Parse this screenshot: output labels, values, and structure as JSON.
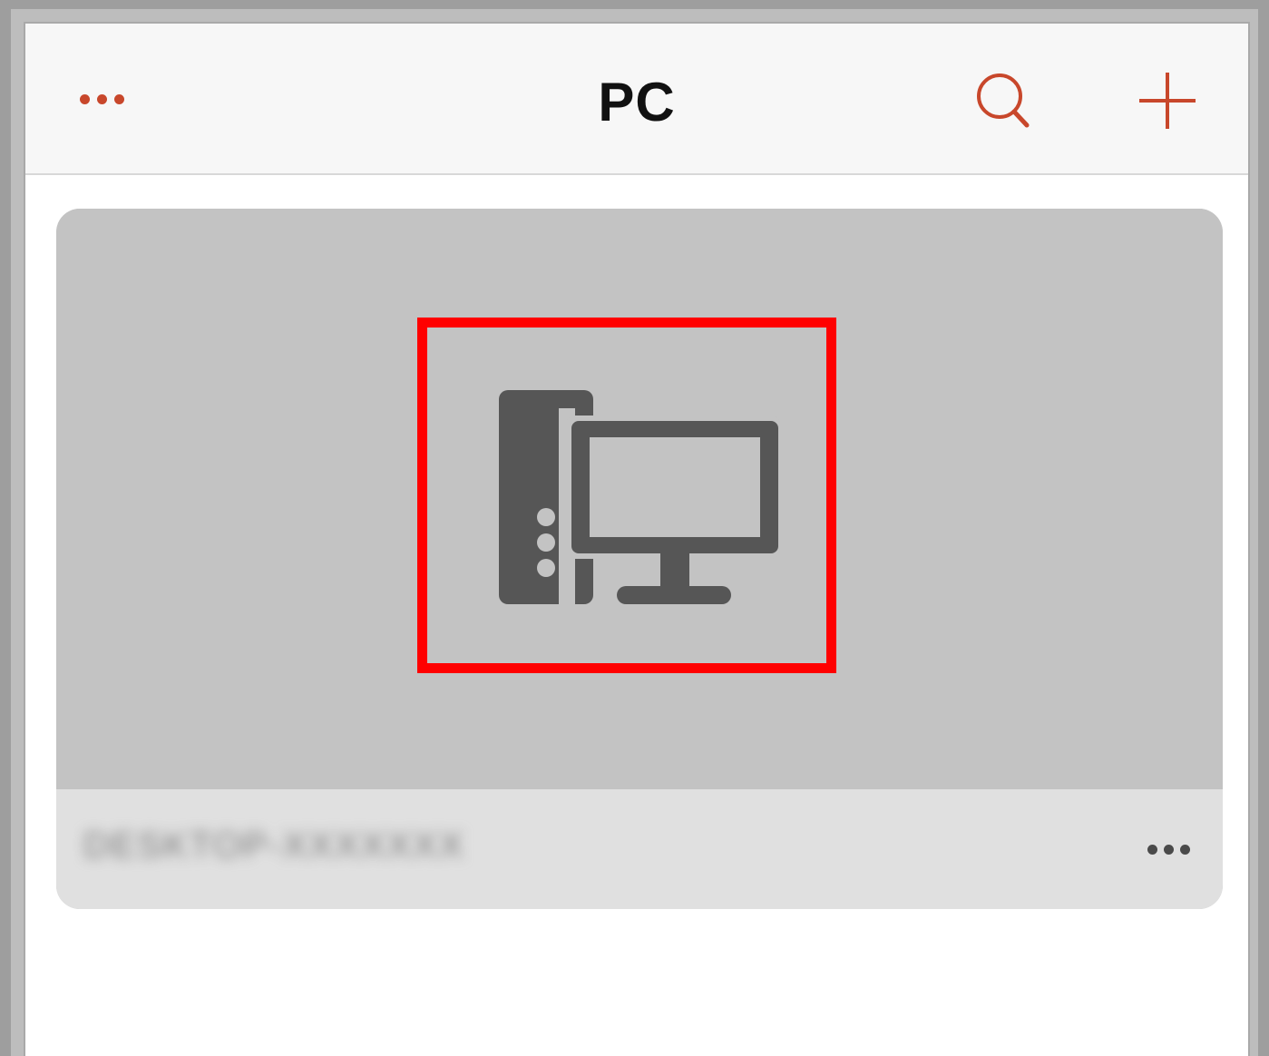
{
  "navbar": {
    "title": "PC",
    "more_icon": "more-horizontal-icon",
    "search_icon": "search-icon",
    "add_icon": "plus-icon",
    "accent_color": "#c8472b"
  },
  "pc_card": {
    "name": "DESKTOP-XXXXXXX",
    "thumbnail_icon": "desktop-computer-icon",
    "more_icon": "more-horizontal-icon",
    "highlight_color": "#ff0000"
  }
}
